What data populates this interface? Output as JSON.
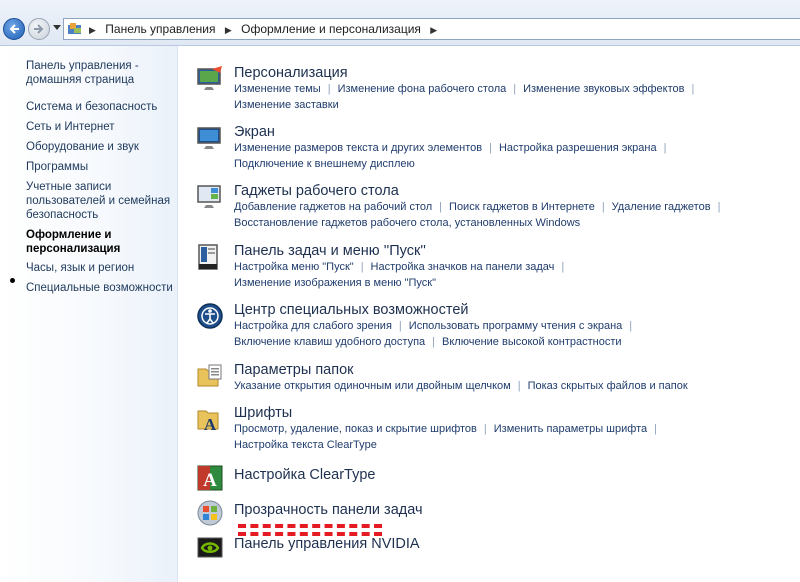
{
  "breadcrumb": [
    "Панель управления",
    "Оформление и персонализация"
  ],
  "sidebar": {
    "home": "Панель управления - домашняя страница",
    "items": [
      {
        "label": "Система и безопасность"
      },
      {
        "label": "Сеть и Интернет"
      },
      {
        "label": "Оборудование и звук"
      },
      {
        "label": "Программы"
      },
      {
        "label": "Учетные записи пользователей и семейная безопасность"
      },
      {
        "label": "Оформление и персонализация",
        "active": true
      },
      {
        "label": "Часы, язык и регион"
      },
      {
        "label": "Специальные возможности"
      }
    ]
  },
  "categories": [
    {
      "title": "Персонализация",
      "icon": "personalization-icon",
      "links": [
        [
          "Изменение темы",
          "Изменение фона рабочего стола",
          "Изменение звуковых эффектов"
        ],
        [
          "Изменение заставки"
        ]
      ]
    },
    {
      "title": "Экран",
      "icon": "display-icon",
      "links": [
        [
          "Изменение размеров текста и других элементов",
          "Настройка разрешения экрана"
        ],
        [
          "Подключение к внешнему дисплею"
        ]
      ]
    },
    {
      "title": "Гаджеты рабочего стола",
      "icon": "gadgets-icon",
      "links": [
        [
          "Добавление гаджетов на рабочий стол",
          "Поиск гаджетов в Интернете",
          "Удаление гаджетов"
        ],
        [
          "Восстановление гаджетов рабочего стола, установленных Windows"
        ]
      ]
    },
    {
      "title": "Панель задач и меню ''Пуск''",
      "icon": "taskbar-icon",
      "links": [
        [
          "Настройка меню \"Пуск\"",
          "Настройка значков на панели задач"
        ],
        [
          "Изменение изображения в меню \"Пуск\""
        ]
      ]
    },
    {
      "title": "Центр специальных возможностей",
      "icon": "ease-of-access-icon",
      "links": [
        [
          "Настройка для слабого зрения",
          "Использовать программу чтения с экрана"
        ],
        [
          "Включение клавиш удобного доступа",
          "Включение высокой контрастности"
        ]
      ]
    },
    {
      "title": "Параметры папок",
      "icon": "folder-options-icon",
      "links": [
        [
          "Указание открытия одиночным или двойным щелчком",
          "Показ скрытых файлов и папок"
        ]
      ]
    },
    {
      "title": "Шрифты",
      "icon": "fonts-icon",
      "links": [
        [
          "Просмотр, удаление, показ и скрытие шрифтов",
          "Изменить параметры шрифта"
        ],
        [
          "Настройка текста ClearType"
        ]
      ]
    },
    {
      "title": "Настройка ClearType",
      "icon": "cleartype-icon",
      "links": []
    },
    {
      "title": "Прозрачность панели задач",
      "icon": "transparency-icon",
      "links": []
    },
    {
      "title": "Панель управления NVIDIA",
      "icon": "nvidia-icon",
      "links": []
    }
  ],
  "colors": {
    "annotation": "#e41b23",
    "link": "#1f3c6c"
  }
}
